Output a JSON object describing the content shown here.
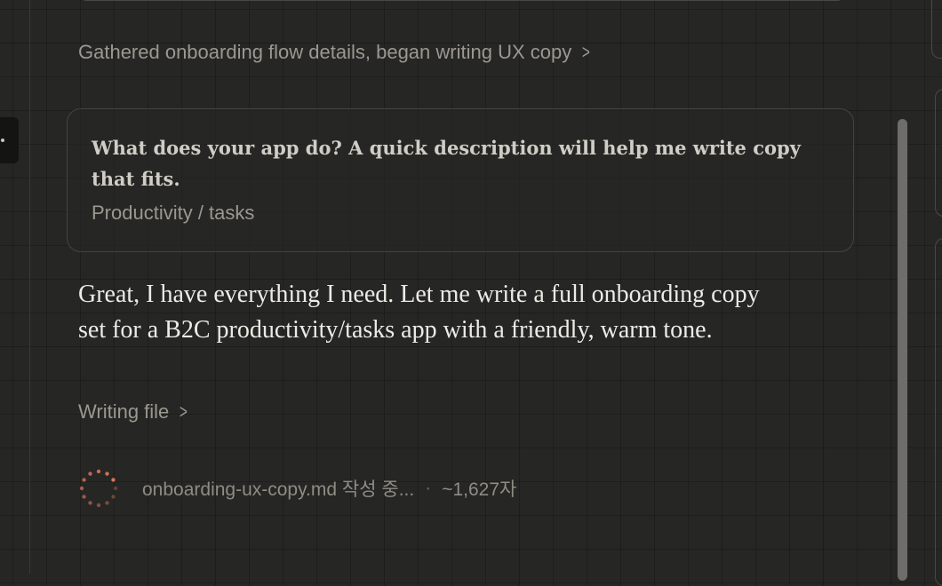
{
  "activity": {
    "summary": "Gathered onboarding flow details, began writing UX copy"
  },
  "question_card": {
    "question": "What does your app do? A quick description will help me write copy that fits.",
    "answer": "Productivity / tasks"
  },
  "assistant": {
    "message": "Great, I have everything I need. Let me write a full onboarding copy set for a B2C productivity/tasks app with a friendly, warm tone."
  },
  "tool": {
    "label": "Writing file"
  },
  "file_status": {
    "filename_progress": "onboarding-ux-copy.md 작성 중...",
    "separator": "·",
    "char_count": "~1,627자"
  },
  "icons": {
    "chevron": "chevron-right-icon",
    "spinner": "loading-spinner-icon"
  },
  "colors": {
    "background": "#262624",
    "spinner_accent": "#d9775a",
    "muted_text": "#9b9890",
    "primary_text": "#ecebe5"
  }
}
